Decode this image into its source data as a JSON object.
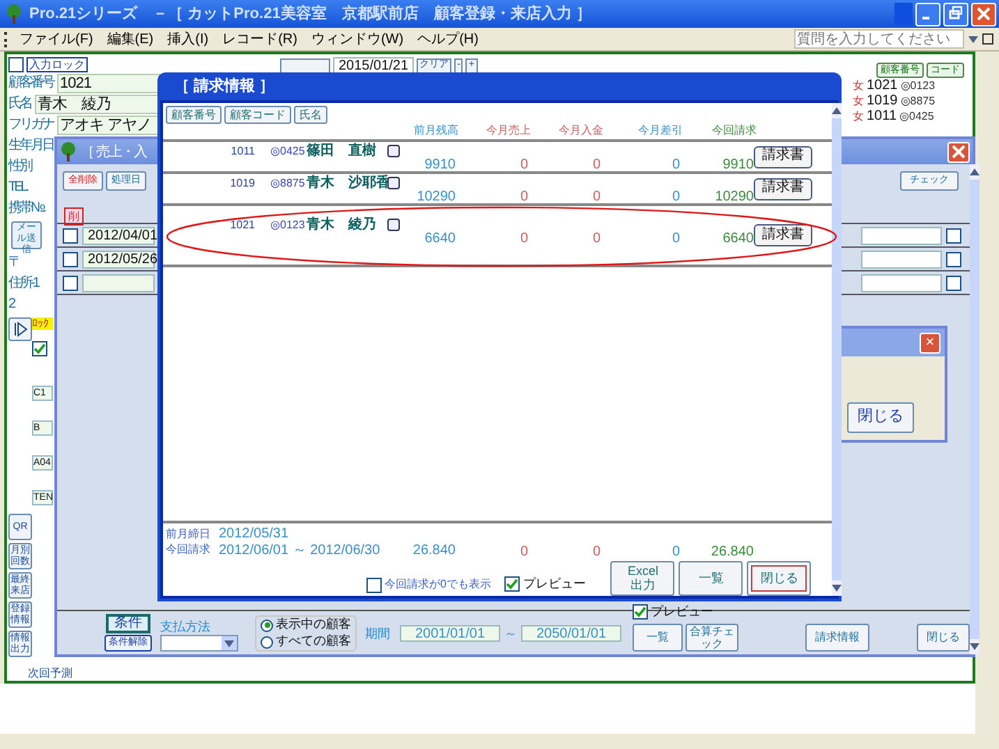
{
  "window": {
    "title": "Pro.21シリーズ　－［ カットPro.21美容室　京都駅前店　顧客登録・来店入力 ］"
  },
  "menu": [
    "ファイル(F)",
    "編集(E)",
    "挿入(I)",
    "レコード(R)",
    "ウィンドウ(W)",
    "ヘルプ(H)"
  ],
  "help_search": {
    "placeholder": "質問を入力してください"
  },
  "customer_form": {
    "input_lock": {
      "label": "入力ロック",
      "checked": false
    },
    "fields": [
      {
        "kind": "field",
        "label": "顧客番号",
        "value": "1021"
      },
      {
        "kind": "field",
        "label": "氏名",
        "value": "青木　綾乃"
      },
      {
        "kind": "field",
        "label": "フリガナ",
        "value": "アオキ アヤノ"
      },
      {
        "kind": "label",
        "label": "生年月日"
      },
      {
        "kind": "label",
        "label": "性別"
      },
      {
        "kind": "label",
        "label": "TEL."
      },
      {
        "kind": "label",
        "label": "携帯№."
      },
      {
        "kind": "button",
        "label": "メール送信"
      },
      {
        "kind": "label",
        "label": "〒"
      },
      {
        "kind": "label",
        "label": "住所-1"
      },
      {
        "kind": "label",
        "label": "2"
      }
    ],
    "date": "2015/01/21",
    "date_buttons": [
      "クリア",
      "-",
      "+"
    ],
    "side_list": {
      "sort_buttons": [
        "顧客番号",
        "コード"
      ],
      "rows": [
        {
          "gender": "女",
          "number": "1021",
          "code": "◎0123"
        },
        {
          "gender": "女",
          "number": "1019",
          "code": "◎8875"
        },
        {
          "gender": "女",
          "number": "1011",
          "code": "◎0425"
        }
      ]
    },
    "lock_tag": "ﾛｯｸ",
    "lock_checked": true,
    "codes": [
      "C1",
      "B",
      "A04",
      "TEN"
    ],
    "side_buttons": [
      "QR",
      "月別回数",
      "最終来店",
      "登録情報",
      "情報出力"
    ],
    "next_label": "次回予測"
  },
  "sales_window": {
    "title": "［ 売上・入",
    "toolbar": [
      "全削除",
      "処理日"
    ],
    "delete_mark": "削",
    "check_button": "チェック",
    "rows": [
      {
        "checked": false,
        "date": "2012/04/01",
        "extra_checked": false
      },
      {
        "checked": false,
        "date": "2012/05/26",
        "extra_checked": false
      },
      {
        "checked": false,
        "date": "",
        "extra_checked": false
      }
    ],
    "filter": {
      "condition_button": "条件",
      "clear_button": "条件解除",
      "payment_label": "支払方法",
      "scope": [
        {
          "label": "表示中の顧客",
          "selected": true
        },
        {
          "label": "すべての顧客",
          "selected": false
        }
      ],
      "period_label": "期間",
      "period_from": "2001/01/01",
      "period_sep": "～",
      "period_to": "2050/01/01",
      "preview": {
        "label": "プレビュー",
        "checked": true
      }
    },
    "buttons": [
      "一覧",
      "合算チェック",
      "請求情報",
      "閉じる"
    ]
  },
  "small_dialog": {
    "close_mark": "×",
    "button": "閉じる"
  },
  "billing_window": {
    "title": "［ 請求情報 ］",
    "sort_buttons": [
      "顧客番号",
      "顧客コード",
      "氏名"
    ],
    "columns": [
      "前月残高",
      "今月売上",
      "今月入金",
      "今月差引",
      "今回請求"
    ],
    "rows": [
      {
        "number": "1011",
        "code": "◎0425",
        "name": "篠田　直樹",
        "values": [
          "9910",
          "0",
          "0",
          "0",
          "9910"
        ],
        "action": "請求書",
        "circled": false
      },
      {
        "number": "1019",
        "code": "◎8875",
        "name": "青木　沙耶香",
        "values": [
          "10290",
          "0",
          "0",
          "0",
          "10290"
        ],
        "action": "請求書",
        "circled": false
      },
      {
        "number": "1021",
        "code": "◎0123",
        "name": "青木　綾乃",
        "values": [
          "6640",
          "0",
          "0",
          "0",
          "6640"
        ],
        "action": "請求書",
        "circled": true
      }
    ],
    "closing_label": "前月締日",
    "closing_date": "2012/05/31",
    "period_label": "今回請求",
    "period": "2012/06/01 ～ 2012/06/30",
    "totals": [
      "26.840",
      "0",
      "0",
      "0",
      "26.840"
    ],
    "show_zero": {
      "label": "今回請求が0でも表示",
      "checked": false
    },
    "preview": {
      "label": "プレビュー",
      "checked": true
    },
    "buttons": [
      "Excel\n出力",
      "一覧",
      "閉じる"
    ]
  }
}
